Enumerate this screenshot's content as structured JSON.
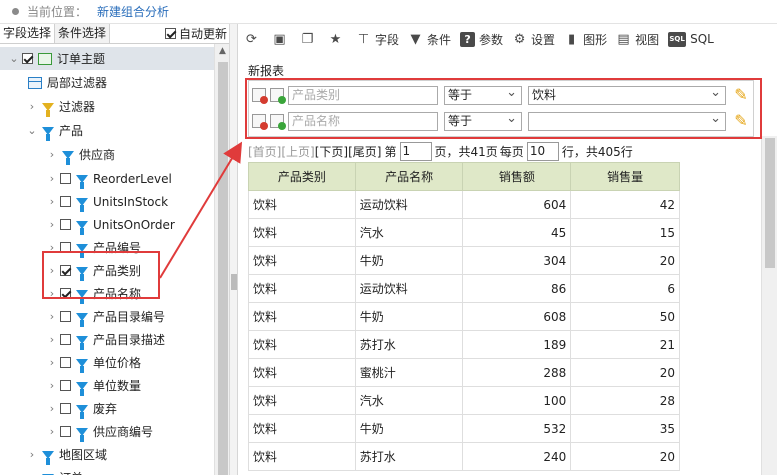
{
  "header": {
    "location_label": "当前位置：",
    "location_value": "新建组合分析"
  },
  "left_panel": {
    "tabs": [
      "字段选择",
      "条件选择"
    ],
    "auto_update_label": "自动更新",
    "auto_update_checked": true
  },
  "tree": {
    "root": "订单主题",
    "local_filter": "局部过滤器",
    "filter": "过滤器",
    "product": "产品",
    "supplier": "供应商",
    "fields": [
      "ReorderLevel",
      "UnitsInStock",
      "UnitsOnOrder",
      "产品编号",
      "产品类别",
      "产品名称",
      "产品目录编号",
      "产品目录描述",
      "单位价格",
      "单位数量",
      "废弃",
      "供应商编号"
    ],
    "checked_fields": [
      "产品类别",
      "产品名称"
    ],
    "map_region": "地图区域",
    "order": "订单"
  },
  "toolbar": {
    "items": [
      {
        "icon": "refresh-icon",
        "label": ""
      },
      {
        "icon": "save-icon",
        "label": ""
      },
      {
        "icon": "save-as-icon",
        "label": ""
      },
      {
        "icon": "star-icon",
        "label": ""
      },
      {
        "icon": "field-icon",
        "label": "字段"
      },
      {
        "icon": "condition-icon",
        "label": "条件"
      },
      {
        "icon": "param-icon",
        "label": "参数"
      },
      {
        "icon": "gear-icon",
        "label": "设置"
      },
      {
        "icon": "chart-icon",
        "label": "图形"
      },
      {
        "icon": "view-icon",
        "label": "视图"
      },
      {
        "icon": "sql-icon",
        "label": "SQL"
      }
    ]
  },
  "report": {
    "title": "新报表",
    "filters": [
      {
        "field_placeholder": "产品类别",
        "operator": "等于",
        "value": "饮料"
      },
      {
        "field_placeholder": "产品名称",
        "operator": "等于",
        "value": ""
      }
    ]
  },
  "pager": {
    "first": "[首页]",
    "prev": "[上页]",
    "next": "[下页]",
    "last": "[尾页]",
    "page_prefix": "第",
    "page_value": "1",
    "page_suffix": "页，共41页",
    "per_page_prefix": "每页",
    "per_page_value": "10",
    "per_page_suffix": "行，共405行"
  },
  "table": {
    "columns": [
      "产品类别",
      "产品名称",
      "销售额",
      "销售量"
    ],
    "rows": [
      [
        "饮料",
        "运动饮料",
        "604",
        "42"
      ],
      [
        "饮料",
        "汽水",
        "45",
        "15"
      ],
      [
        "饮料",
        "牛奶",
        "304",
        "20"
      ],
      [
        "饮料",
        "运动饮料",
        "86",
        "6"
      ],
      [
        "饮料",
        "牛奶",
        "608",
        "50"
      ],
      [
        "饮料",
        "苏打水",
        "189",
        "21"
      ],
      [
        "饮料",
        "蜜桃汁",
        "288",
        "20"
      ],
      [
        "饮料",
        "汽水",
        "100",
        "28"
      ],
      [
        "饮料",
        "牛奶",
        "532",
        "35"
      ],
      [
        "饮料",
        "苏打水",
        "240",
        "20"
      ]
    ]
  },
  "colors": {
    "accent": "#2a6ebb",
    "filter_icon": "#1e8fd9",
    "highlight": "#e03b3b",
    "table_header": "#dfe8c8"
  }
}
